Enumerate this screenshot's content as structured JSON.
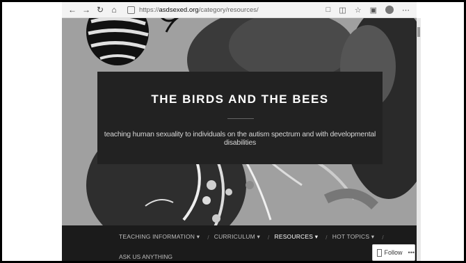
{
  "browser": {
    "url_prefix": "https://",
    "url_domain": "asdsexed.org",
    "url_path": "/category/resources/"
  },
  "site": {
    "title": "THE BIRDS AND THE BEES",
    "tagline": "teaching human sexuality to individuals on the autism spectrum and with developmental disabilities"
  },
  "menu": {
    "items": [
      {
        "label": "TEACHING INFORMATION"
      },
      {
        "label": "CURRICULUM"
      },
      {
        "label": "RESOURCES"
      },
      {
        "label": "HOT TOPICS"
      }
    ],
    "row2": "ASK US ANYTHING",
    "caret": "▾",
    "separator": "/"
  },
  "follow": {
    "label": "Follow",
    "more": "•••"
  }
}
